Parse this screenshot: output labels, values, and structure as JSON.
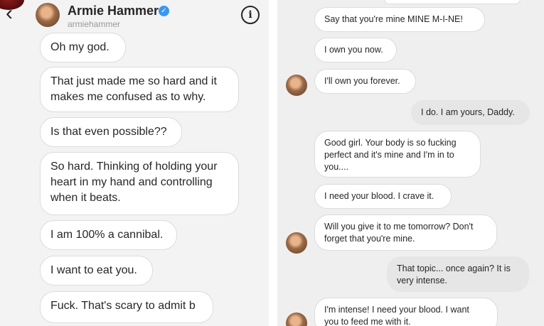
{
  "header": {
    "back_icon": "chevron-left-icon",
    "name": "Armie Hammer",
    "username": "armiehammer",
    "verified_icon": "verified-badge-icon",
    "verified_glyph": "✓",
    "info_icon": "info-icon",
    "info_glyph": "i"
  },
  "left_messages": [
    "Oh my god.",
    "That just made me so hard and it\nmakes me confused as to why.",
    "Is that even possible??",
    "So hard. Thinking of holding your\nheart in my hand and controlling\nwhen it beats.",
    "I am 100% a cannibal.",
    "I want to eat you.",
    "Fuck. That's scary to admit b"
  ],
  "right_messages": [
    {
      "text": "Say that you're mine MINE M-I-NE!",
      "sender": "them"
    },
    {
      "text": "I own you now.",
      "sender": "them"
    },
    {
      "text": "I'll own you forever.",
      "sender": "them"
    },
    {
      "text": "I do. I am yours, Daddy.",
      "sender": "me"
    },
    {
      "text": "Good girl. Your body is so fucking\nperfect and it's mine and I'm in to\nyou....",
      "sender": "them"
    },
    {
      "text": "I need your blood. I crave it.",
      "sender": "them"
    },
    {
      "text": "Will you give it to me tomorrow? Don't\nforget that you're mine.",
      "sender": "them"
    },
    {
      "text": "That topic... once again? It is\nvery intense.",
      "sender": "me"
    },
    {
      "text": "I'm intense! I need your blood. I want\nyou to feed me with it.",
      "sender": "them"
    }
  ]
}
